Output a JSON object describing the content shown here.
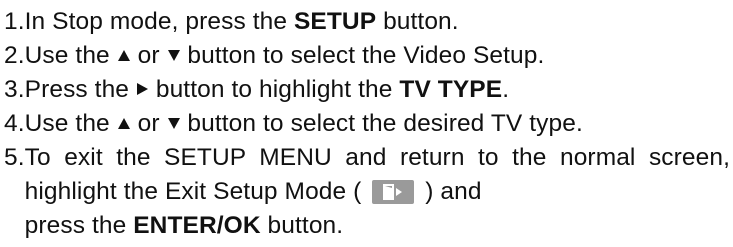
{
  "steps": [
    {
      "num": "1.",
      "t1": "In Stop mode, press the ",
      "b1": "SETUP",
      "t2": " button."
    },
    {
      "num": "2.",
      "t1": "Use the ",
      "or": " or ",
      "t2": " button to select the Video Setup.",
      "up_icon": "up-triangle",
      "down_icon": "down-triangle"
    },
    {
      "num": "3.",
      "t1": "Press the ",
      "t2": " button to highlight the ",
      "b1": "TV TYPE",
      "t3": ".",
      "right_icon": "right-triangle"
    },
    {
      "num": "4.",
      "t1": "Use the ",
      "or": " or ",
      "t2": " button to select the desired TV type.",
      "up_icon": "up-triangle",
      "down_icon": "down-triangle"
    },
    {
      "num": "5.",
      "t1": "To exit the SETUP MENU and return to the normal screen, highlight the Exit Setup Mode ( ",
      "t2": " ) and",
      "t3": "press the ",
      "b1": "ENTER/OK",
      "t4": " button.",
      "exit_icon": "exit-door-icon"
    }
  ],
  "colors": {
    "text": "#111111",
    "icon_bg": "#9a9a9a",
    "icon_fg": "#ffffff"
  }
}
